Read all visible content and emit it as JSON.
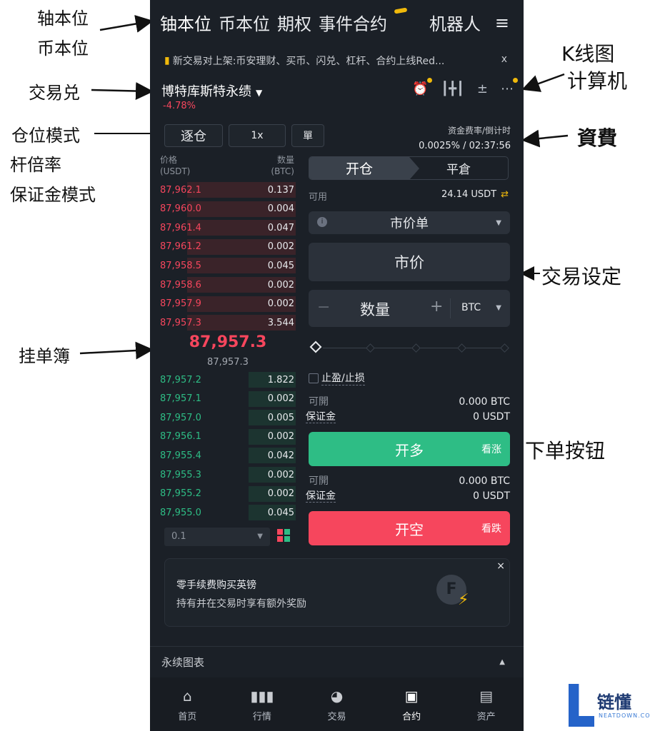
{
  "annotations": {
    "coin_m": "轴本位",
    "usdt_m": "币本位",
    "pair": "交易兑",
    "position_mode": "仓位模式",
    "leverage": "杆倍率",
    "margin_mode": "保证金模式",
    "kline": "K线图",
    "calculator": "计算机",
    "funding": "資費",
    "trade_settings": "交易设定",
    "orderbook": "挂单簿",
    "order_button": "下单按钮"
  },
  "topnav": {
    "tabs": [
      "铀本位",
      "币本位",
      "期权",
      "事件合约"
    ],
    "robot": "机器人",
    "menu_icon": "≡"
  },
  "notice": {
    "text": "新交易对上架:币安理财、买币、闪兑、杠杆、合约上线Red...",
    "close": "x"
  },
  "pair": {
    "name": "博特库斯特永绩",
    "change": "-4.78%"
  },
  "settings": {
    "margin_mode": "逐仓",
    "leverage": "1x",
    "position_mode": "單"
  },
  "funding": {
    "label": "资金费率/倒计时",
    "value": "0.0025% / 02:37:56"
  },
  "orderbook": {
    "price_header": "价格",
    "price_unit": "(USDT)",
    "qty_header": "数量",
    "qty_unit": "(BTC)",
    "asks": [
      {
        "price": "87,962.1",
        "qty": "0.137",
        "depth": 0.8
      },
      {
        "price": "87,960.0",
        "qty": "0.004",
        "depth": 0.8
      },
      {
        "price": "87,961.4",
        "qty": "0.047",
        "depth": 0.8
      },
      {
        "price": "87,961.2",
        "qty": "0.002",
        "depth": 0.8
      },
      {
        "price": "87,958.5",
        "qty": "0.045",
        "depth": 0.8
      },
      {
        "price": "87,958.6",
        "qty": "0.002",
        "depth": 0.8
      },
      {
        "price": "87,957.9",
        "qty": "0.002",
        "depth": 0.8
      },
      {
        "price": "87,957.3",
        "qty": "3.544",
        "depth": 0.8
      }
    ],
    "mid_price": "87,957.3",
    "mark_price": "87,957.3",
    "bids": [
      {
        "price": "87,957.2",
        "qty": "1.822",
        "depth": 0.35
      },
      {
        "price": "87,957.1",
        "qty": "0.002",
        "depth": 0.35
      },
      {
        "price": "87,957.0",
        "qty": "0.005",
        "depth": 0.35
      },
      {
        "price": "87,956.1",
        "qty": "0.002",
        "depth": 0.35
      },
      {
        "price": "87,955.4",
        "qty": "0.042",
        "depth": 0.35
      },
      {
        "price": "87,955.3",
        "qty": "0.002",
        "depth": 0.35
      },
      {
        "price": "87,955.2",
        "qty": "0.002",
        "depth": 0.35
      },
      {
        "price": "87,955.0",
        "qty": "0.045",
        "depth": 0.35
      }
    ],
    "precision": "0.1"
  },
  "order": {
    "open_tab": "开仓",
    "close_tab": "平倉",
    "available_label": "可用",
    "available_value": "24.14 USDT",
    "order_type": "市价单",
    "price_placeholder": "市价",
    "qty_placeholder": "数量",
    "qty_unit": "BTC",
    "tpsl": "止盈/止损",
    "long": {
      "open_label": "可開",
      "open_value": "0.000 BTC",
      "margin_label": "保证金",
      "margin_value": "0 USDT",
      "button": "开多",
      "side": "看涨"
    },
    "short": {
      "open_label": "可開",
      "open_value": "0.000 BTC",
      "margin_label": "保证金",
      "margin_value": "0 USDT",
      "button": "开空",
      "side": "看跌"
    }
  },
  "promo": {
    "title": "零手续费购买英镑",
    "subtitle": "持有并在交易时享有额外奖励",
    "close": "×"
  },
  "chart_section": "永续图表",
  "bottomnav": [
    {
      "label": "首页",
      "icon": "home-icon"
    },
    {
      "label": "行情",
      "icon": "market-icon"
    },
    {
      "label": "交易",
      "icon": "trade-icon"
    },
    {
      "label": "合约",
      "icon": "futures-icon"
    },
    {
      "label": "资产",
      "icon": "wallet-icon"
    }
  ],
  "watermark": {
    "name": "链懂",
    "site": "NEATDOWN.COM"
  }
}
